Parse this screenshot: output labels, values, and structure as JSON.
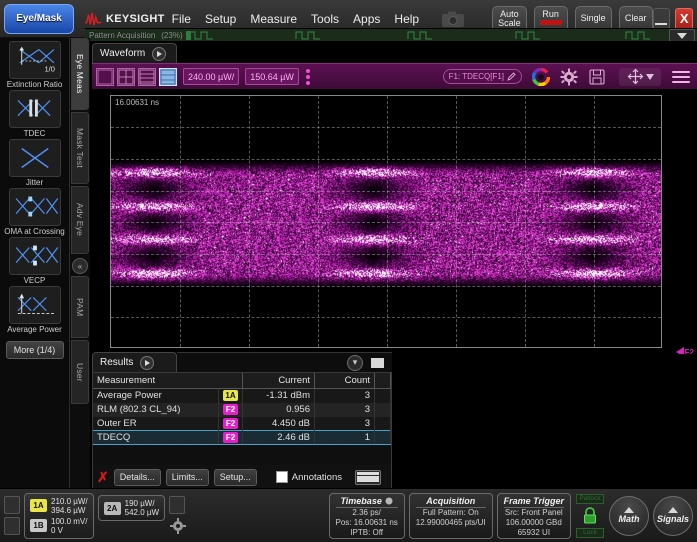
{
  "app": {
    "mode_button": "Eye/Mask",
    "brand": "KEYSIGHT",
    "menus": [
      "File",
      "Setup",
      "Measure",
      "Tools",
      "Apps",
      "Help"
    ],
    "controls": {
      "autoscale": "Auto\nScale",
      "autoscale_line1": "Auto",
      "autoscale_line2": "Scale",
      "run": "Run",
      "single": "Single",
      "clear": "Clear",
      "close": "X"
    }
  },
  "pattern_acquisition": {
    "label": "Pattern Acquisition",
    "percent": "(23%)"
  },
  "sidebar": {
    "items": [
      {
        "label": "Extinction Ratio",
        "icon": "eye-extinction-ratio-icon"
      },
      {
        "label": "TDEC",
        "icon": "eye-tdec-icon"
      },
      {
        "label": "Jitter",
        "icon": "eye-jitter-icon"
      },
      {
        "label": "OMA at Crossing",
        "icon": "eye-oma-crossing-icon"
      },
      {
        "label": "VECP",
        "icon": "eye-vecp-icon"
      },
      {
        "label": "Average Power",
        "icon": "eye-average-power-icon"
      }
    ],
    "more_button": "More (1/4)"
  },
  "vertical_tabs": [
    {
      "label": "Eye Meas",
      "active": true
    },
    {
      "label": "Mask Test",
      "active": false
    },
    {
      "label": "Adv Eye",
      "active": false
    },
    {
      "label": "PAM",
      "active": false
    },
    {
      "label": "User",
      "active": false
    }
  ],
  "waveform_panel": {
    "tab_label": "Waveform",
    "vertical_scale": "240.00 µW/",
    "vertical_offset": "150.64 µW",
    "function_pill": "F1: TDECQ[F1]",
    "grid_layouts": [
      "layout-single",
      "layout-quad",
      "layout-stacked",
      "layout-overlay"
    ],
    "selected_layout_index": 3
  },
  "scope": {
    "time_label": "16.00631 ns",
    "marker_label": "F2",
    "trace_color": "#d636c8"
  },
  "results": {
    "tab_label": "Results",
    "columns": [
      "Measurement",
      "Current",
      "Count"
    ],
    "rows": [
      {
        "measurement": "Average Power",
        "badge": "1A",
        "badge_type": "1a",
        "current": "-1.31 dBm",
        "count": "3",
        "selected": false
      },
      {
        "measurement": "RLM (802.3 CL_94)",
        "badge": "F2",
        "badge_type": "f2",
        "current": "0.956",
        "count": "3",
        "selected": false
      },
      {
        "measurement": "Outer ER",
        "badge": "F2",
        "badge_type": "f2",
        "current": "4.450 dB",
        "count": "3",
        "selected": false
      },
      {
        "measurement": "TDECQ",
        "badge": "F2",
        "badge_type": "f2",
        "current": "2.46 dB",
        "count": "1",
        "selected": true
      }
    ],
    "buttons": [
      "Details...",
      "Limits...",
      "Setup..."
    ],
    "annotations_label": "Annotations"
  },
  "status_bar": {
    "channels": [
      {
        "badge": "1A",
        "badge_type": "1a",
        "line1": "210.0 µW/",
        "line2": "394.6 µW"
      },
      {
        "badge": "1B",
        "badge_type": "1b",
        "line1": "100.0 mV/",
        "line2": "0 V"
      },
      {
        "badge": "2A",
        "badge_type": "2a",
        "line1": "190 µW/",
        "line2": "542.0 µW"
      }
    ],
    "timebase": {
      "title": "Timebase",
      "lines": [
        "2.36 ps/",
        "Pos: 16.00631 ns",
        "IPTB: Off"
      ]
    },
    "acquisition": {
      "title": "Acquisition",
      "lines": [
        "Full Pattern: On",
        "12.99000465 pts/UI"
      ]
    },
    "frame_trigger": {
      "title": "Frame Trigger",
      "lines": [
        "Src: Front Panel",
        "106.00000 GBd",
        "65932 UI"
      ]
    },
    "lock": {
      "top_tag": "Patlock",
      "bottom_tag": "Lock"
    },
    "math_button": "Math",
    "signals_button": "Signals"
  }
}
